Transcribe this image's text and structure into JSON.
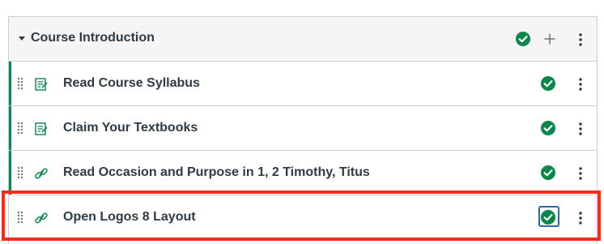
{
  "module": {
    "title": "Course Introduction",
    "published": true,
    "caret_icon": "caret-down-icon",
    "add_icon": "plus-icon",
    "menu_icon": "kebab-menu-icon"
  },
  "items": [
    {
      "title": "Read Course Syllabus",
      "type_icon": "assignment-icon",
      "published": true
    },
    {
      "title": "Claim Your Textbooks",
      "type_icon": "assignment-icon",
      "published": true
    },
    {
      "title": "Read Occasion and Purpose in 1, 2 Timothy, Titus",
      "type_icon": "link-icon",
      "published": true
    },
    {
      "title": "Open Logos 8 Layout",
      "type_icon": "link-icon",
      "published": true,
      "highlighted": true
    }
  ],
  "colors": {
    "published_green": "#0b874b",
    "header_bg": "#f5f5f5",
    "border": "#c7cdd1",
    "text": "#2d3b45",
    "highlight_red": "#ff2a1a",
    "focus_blue": "#2a6aa8"
  }
}
